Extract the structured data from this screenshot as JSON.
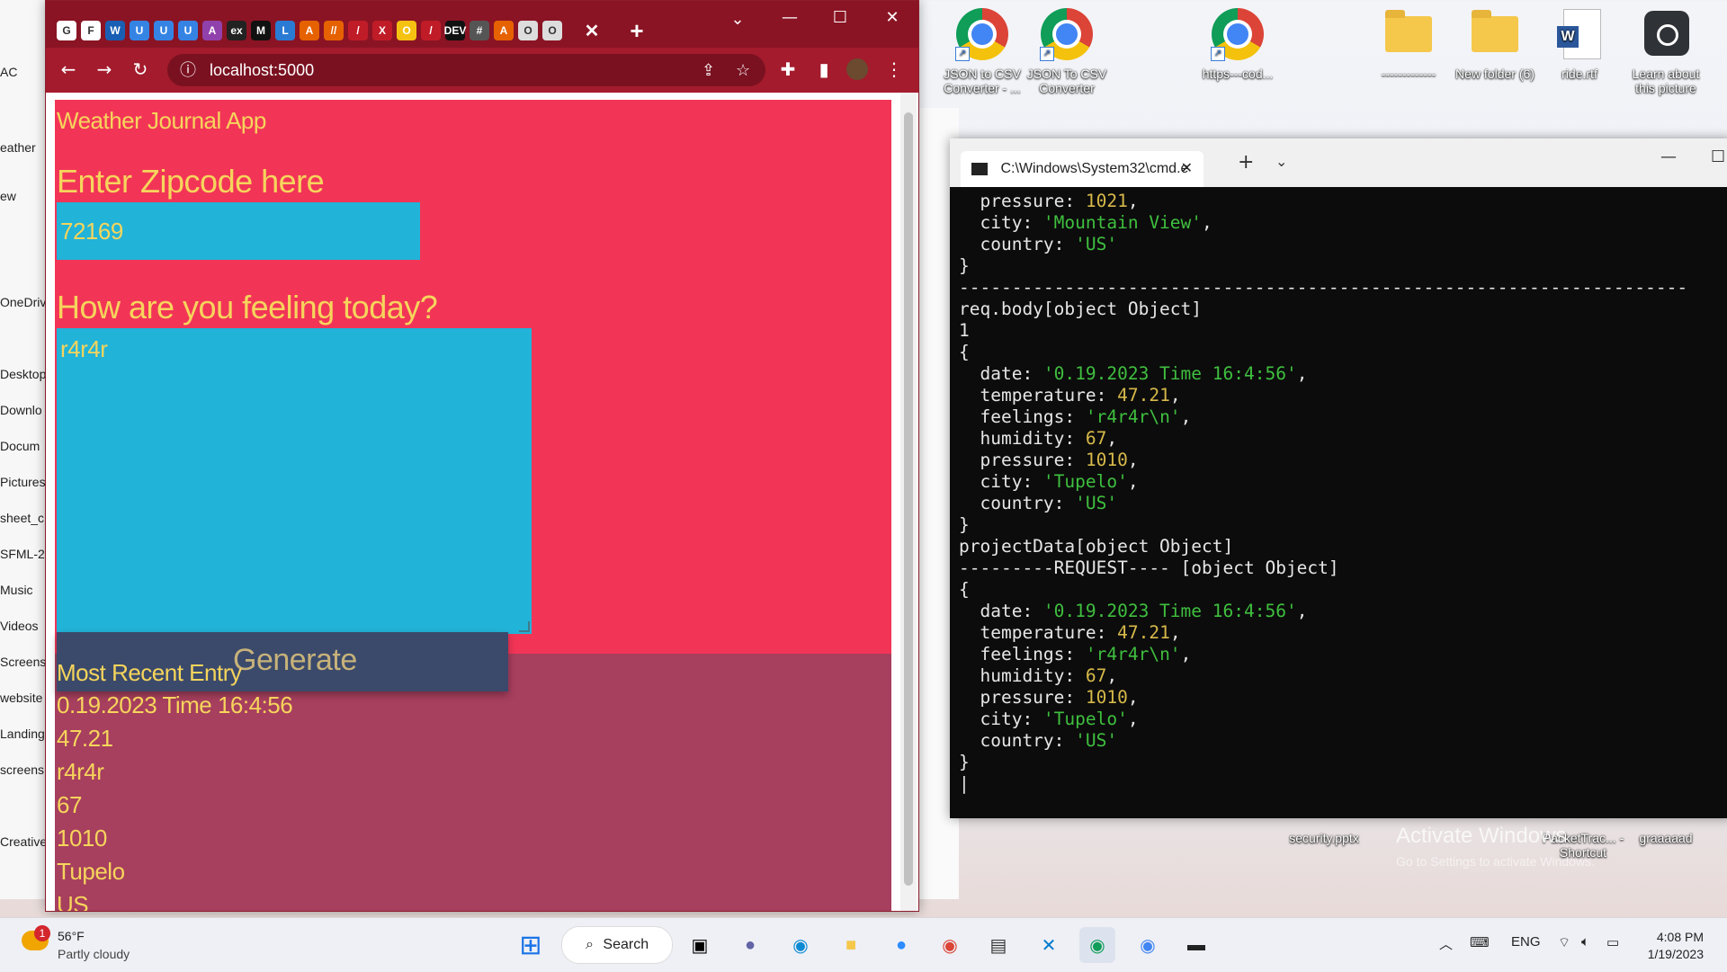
{
  "desktop": {
    "icons": [
      {
        "label": "JSON to CSV Converter - ..."
      },
      {
        "label": "JSON To CSV Converter"
      },
      {
        "label": "https---cod..."
      },
      {
        "label": "-------------"
      },
      {
        "label": "New folder (6)"
      },
      {
        "label": "ride.rtf"
      },
      {
        "label": "Learn about this picture"
      },
      {
        "label": "security.pptx"
      },
      {
        "label": "PacketTrac... - Shortcut"
      },
      {
        "label": "graaaaad"
      }
    ],
    "watermark": {
      "line1": "Activate Windows",
      "line2": "Go to Settings to activate Windows."
    }
  },
  "explorer": {
    "items": [
      "AC",
      "eather",
      "ew",
      "OneDriv",
      "Desktop",
      "Downlo",
      "Docum",
      "Pictures",
      "sheet_c",
      "SFML-2",
      "Music",
      "Videos",
      "Screens",
      "website",
      "Landing",
      "screens",
      "Creative"
    ]
  },
  "browser": {
    "url": "localhost:5000",
    "tab_icons": [
      "G",
      "F",
      "W",
      "U",
      "U",
      "U",
      "A",
      "ex",
      "M",
      "L",
      "A",
      "//",
      "/",
      "X",
      "O",
      "/",
      "DEV",
      "#",
      "A",
      "O",
      "O"
    ],
    "page": {
      "app_title": "Weather Journal App",
      "zip_label": "Enter Zipcode here",
      "zip_value": "72169",
      "feeling_label": "How are you feeling today?",
      "feeling_value": "r4r4r",
      "generate_label": "Generate",
      "entry_title": "Most Recent Entry",
      "entry": {
        "date": "0.19.2023 Time 16:4:56",
        "temp": "47.21",
        "feelings": "r4r4r",
        "humidity": "67",
        "pressure": "1010",
        "city": "Tupelo",
        "country": "US"
      }
    }
  },
  "terminal": {
    "tab_title": "C:\\Windows\\System32\\cmd.e",
    "lines": [
      "  pressure: 1021,",
      "  city: 'Mountain View',",
      "  country: 'US'",
      "}",
      "---------------------------------------------------------------------",
      "req.body[object Object]",
      "1",
      "{",
      "  date: '0.19.2023 Time 16:4:56',",
      "  temperature: 47.21,",
      "  feelings: 'r4r4r\\n',",
      "  humidity: 67,",
      "  pressure: 1010,",
      "  city: 'Tupelo',",
      "  country: 'US'",
      "}",
      "projectData[object Object]",
      "---------REQUEST---- [object Object]",
      "{",
      "  date: '0.19.2023 Time 16:4:56',",
      "  temperature: 47.21,",
      "  feelings: 'r4r4r\\n',",
      "  humidity: 67,",
      "  pressure: 1010,",
      "  city: 'Tupelo',",
      "  country: 'US'",
      "}",
      "|"
    ]
  },
  "taskbar": {
    "weather_temp": "56°F",
    "weather_desc": "Partly cloudy",
    "weather_badge": "1",
    "search_label": "Search",
    "language": "ENG",
    "time": "4:08 PM",
    "date": "1/19/2023"
  }
}
